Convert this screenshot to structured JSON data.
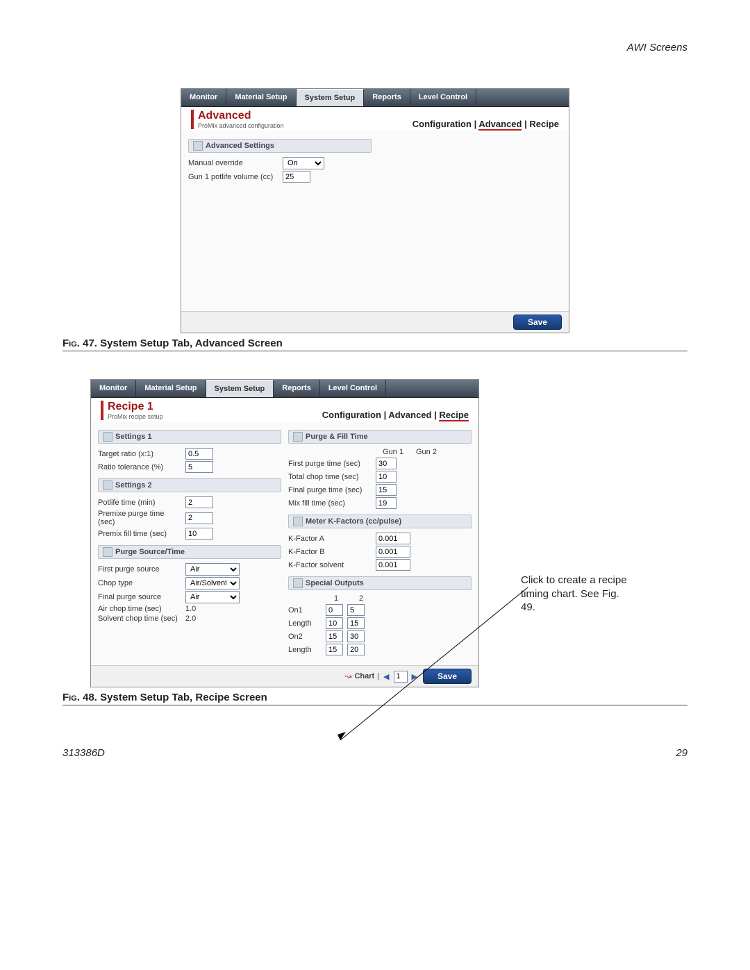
{
  "doc": {
    "header": "AWI Screens",
    "footer_left": "313386D",
    "footer_right": "29"
  },
  "tabs": [
    "Monitor",
    "Material Setup",
    "System Setup",
    "Reports",
    "Level Control"
  ],
  "fig47": {
    "caption_prefix": "Fig. 47. ",
    "caption": "System Setup Tab, Advanced Screen",
    "title": "Advanced",
    "subtitle": "ProMix advanced configuration",
    "breadcrumb": [
      "Configuration",
      "Advanced",
      "Recipe"
    ],
    "breadcrumb_active": "Advanced",
    "panel": "Advanced Settings",
    "manual_override_label": "Manual override",
    "manual_override_value": "On",
    "gun1_label": "Gun 1 potlife volume (cc)",
    "gun1_value": "25",
    "save": "Save"
  },
  "fig48": {
    "caption_prefix": "Fig. 48. ",
    "caption": "System Setup Tab, Recipe Screen",
    "title": "Recipe 1",
    "subtitle": "ProMix recipe setup",
    "breadcrumb": [
      "Configuration",
      "Advanced",
      "Recipe"
    ],
    "breadcrumb_active": "Recipe",
    "settings1": {
      "head": "Settings 1",
      "target_ratio_label": "Target ratio (x:1)",
      "target_ratio": "0.5",
      "ratio_tol_label": "Ratio tolerance (%)",
      "ratio_tol": "5"
    },
    "settings2": {
      "head": "Settings 2",
      "potlife_label": "Potlife time (min)",
      "potlife": "2",
      "premix_purge_label": "Premixe purge time (sec)",
      "premix_purge": "2",
      "premix_fill_label": "Premix fill time (sec)",
      "premix_fill": "10"
    },
    "purge_src": {
      "head": "Purge Source/Time",
      "first_src_label": "First purge source",
      "first_src": "Air",
      "chop_label": "Chop type",
      "chop": "Air/Solvent",
      "final_src_label": "Final purge source",
      "final_src": "Air",
      "air_chop_label": "Air chop time (sec)",
      "air_chop": "1.0",
      "solv_chop_label": "Solvent chop time (sec)",
      "solv_chop": "2.0"
    },
    "purge_fill": {
      "head": "Purge & Fill Time",
      "gun1": "Gun 1",
      "gun2": "Gun 2",
      "first_purge_label": "First purge time (sec)",
      "first_purge": "30",
      "total_chop_label": "Total chop time (sec)",
      "total_chop": "10",
      "final_purge_label": "Final purge time (sec)",
      "final_purge": "15",
      "mix_fill_label": "Mix fill time (sec)",
      "mix_fill": "19"
    },
    "kfactors": {
      "head": "Meter K-Factors (cc/pulse)",
      "ka_label": "K-Factor A",
      "ka": "0.001",
      "kb_label": "K-Factor B",
      "kb": "0.001",
      "ks_label": "K-Factor solvent",
      "ks": "0.001"
    },
    "special": {
      "head": "Special Outputs",
      "col1": "1",
      "col2": "2",
      "on1_label": "On1",
      "on1_1": "0",
      "on1_2": "5",
      "len1_label": "Length",
      "len1_1": "10",
      "len1_2": "15",
      "on2_label": "On2",
      "on2_1": "15",
      "on2_2": "30",
      "len2_label": "Length",
      "len2_1": "15",
      "len2_2": "20"
    },
    "chart_label": "Chart",
    "chart_page": "1",
    "save": "Save",
    "annotation": "Click to create a recipe timing chart. See Fig. 49."
  }
}
